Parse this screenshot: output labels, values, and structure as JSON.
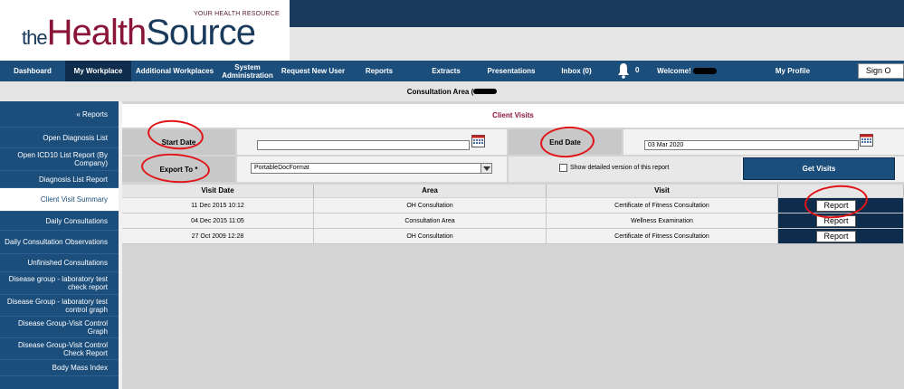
{
  "header": {
    "logo_the": "the",
    "logo_health": "Health",
    "logo_source": "Source",
    "tagline": "YOUR HEALTH RESOURCE"
  },
  "nav": {
    "items": [
      {
        "label": "Dashboard",
        "active": false
      },
      {
        "label": "My Workplace",
        "active": true
      },
      {
        "label": "Additional Workplaces",
        "active": false
      },
      {
        "label": "System Administration",
        "active": false
      },
      {
        "label": "Request New User",
        "active": false
      },
      {
        "label": "Reports",
        "active": false
      },
      {
        "label": "Extracts",
        "active": false
      },
      {
        "label": "Presentations",
        "active": false
      },
      {
        "label": "Inbox (0)",
        "active": false
      }
    ],
    "notifications_count": "0",
    "welcome": "Welcome!",
    "my_profile": "My Profile",
    "sign_out": "Sign O"
  },
  "subheader": {
    "title": "Consultation Area ("
  },
  "sidebar": {
    "back": "« Reports",
    "items": [
      {
        "label": "Open Diagnosis List"
      },
      {
        "label": "Open ICD10 List Report (By Company)"
      },
      {
        "label": "Diagnosis List Report"
      },
      {
        "label": "Client Visit Summary",
        "active": true
      },
      {
        "label": "Daily Consultations"
      },
      {
        "label": "Daily Consultation Observations"
      },
      {
        "label": "Unfinished Consultations"
      },
      {
        "label": "Disease group - laboratory test check report"
      },
      {
        "label": "Disease Group - laboratory test control graph"
      },
      {
        "label": "Disease Group-Visit Control Graph"
      },
      {
        "label": "Disease Group-Visit Control Check Report"
      },
      {
        "label": "Body Mass Index"
      }
    ]
  },
  "main": {
    "section_title": "Client Visits",
    "start_date_label": "Start Date",
    "start_date_value": "",
    "end_date_label": "End Date",
    "end_date_value": "03 Mar 2020",
    "export_label": "Export To *",
    "export_value": "PortableDocFormat",
    "detailed_label": "Show detailed version of this report",
    "get_visits": "Get Visits"
  },
  "table": {
    "headers": [
      "Visit Date",
      "Area",
      "Visit",
      ""
    ],
    "rows": [
      {
        "date": "11 Dec 2015 10:12",
        "area": "OH Consultation",
        "visit": "Certificate of Fitness Consultation",
        "action": "Report"
      },
      {
        "date": "04 Dec 2015 11:05",
        "area": "Consultation Area",
        "visit": "Wellness Examination",
        "action": "Report"
      },
      {
        "date": "27 Oct 2009 12:28",
        "area": "OH Consultation",
        "visit": "Certificate of Fitness Consultation",
        "action": "Report"
      }
    ]
  },
  "colors": {
    "nav_bg": "#1c4e7c",
    "nav_active": "#0e2c4b",
    "brand_red": "#8a1538",
    "brand_blue": "#1a3a5c",
    "annotation": "#e0151a"
  }
}
